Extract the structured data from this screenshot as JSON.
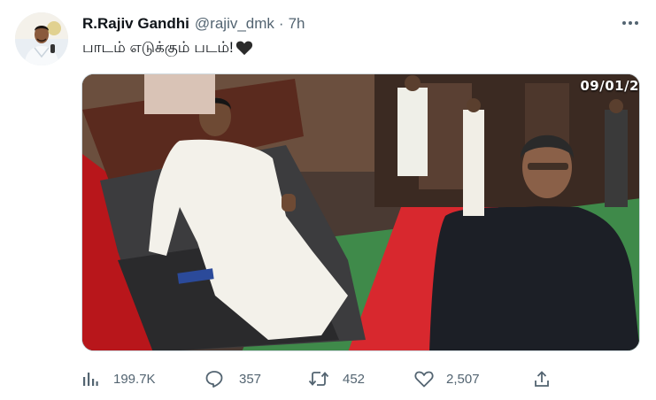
{
  "user": {
    "display_name": "R.Rajiv Gandhi",
    "handle": "@rajiv_dmk",
    "separator": "·",
    "time": "7h",
    "avatar_icon": "avatar-photo"
  },
  "tweet": {
    "text": "பாடம் எடுக்கும் படம்!",
    "emoji_icon": "black-heart-icon"
  },
  "media": {
    "date_overlay": "09/01/2"
  },
  "actions": {
    "views": "199.7K",
    "replies": "357",
    "retweets": "452",
    "likes": "2,507"
  },
  "colors": {
    "text_primary": "#0f1419",
    "text_secondary": "#536471",
    "border": "#cfd9de"
  }
}
